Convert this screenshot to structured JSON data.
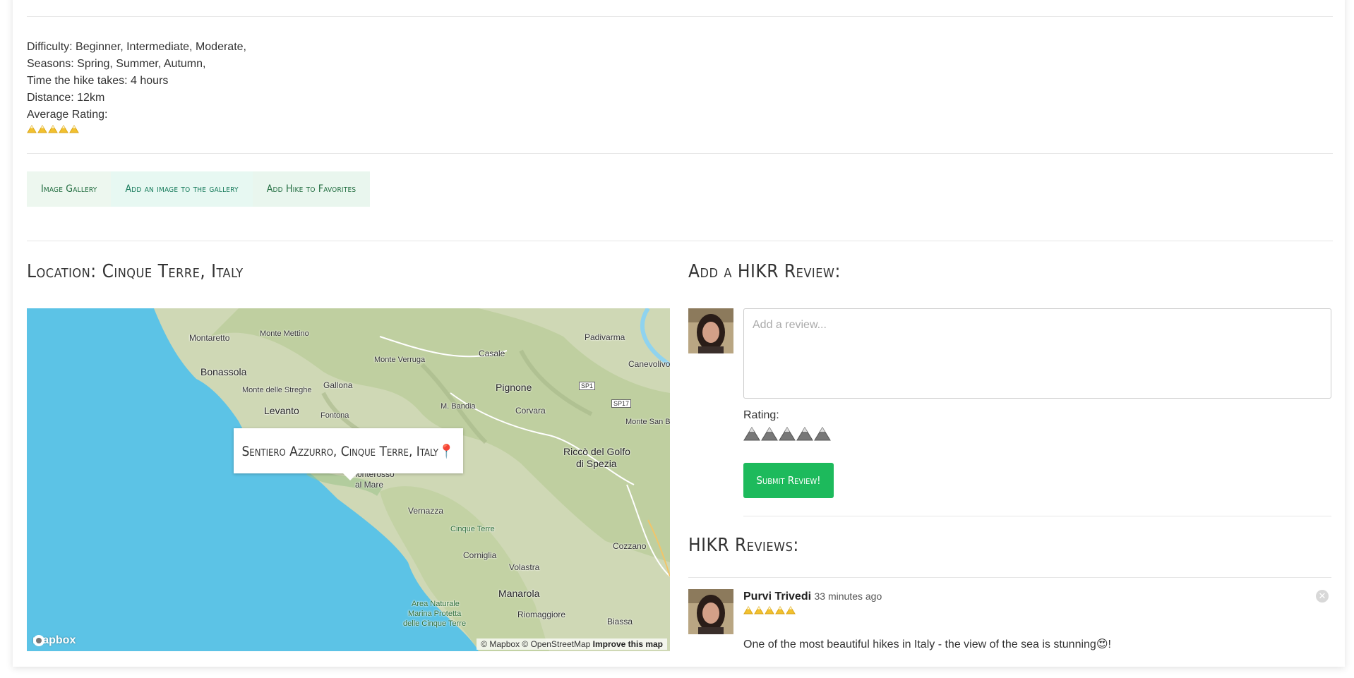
{
  "details": {
    "difficulty": "Difficulty: Beginner, Intermediate, Moderate,",
    "seasons": "Seasons: Spring, Summer, Autumn,",
    "time": "Time the hike takes: 4 hours",
    "distance": "Distance: 12km",
    "avg_label": "Average Rating:",
    "avg_rating": 5
  },
  "buttons": {
    "gallery": "Image Gallery",
    "add_image": "Add an image to the gallery",
    "favorites": "Add Hike to Favorites"
  },
  "location": {
    "heading": "Location: Cinque Terre, Italy",
    "popup": "Sentiero Azzurro, Cinque Terre, Italy📍"
  },
  "map": {
    "labels": {
      "montaretto": "Montaretto",
      "monte_mettino": "Monte Mettino",
      "padivarma": "Padivarma",
      "bonassola": "Bonassola",
      "monte_verruga": "Monte Verruga",
      "casale": "Casale",
      "canevolivo": "Canevolivo",
      "gallona": "Gallona",
      "monte_streghe": "Monte delle Streghe",
      "pignone": "Pignone",
      "sp1": "SP1",
      "levanto": "Levanto",
      "fontona": "Fontona",
      "m_bandia": "M. Bandia",
      "corvara": "Corvara",
      "sp17": "SP17",
      "monte_san_b": "Monte San B",
      "ricco": "Riccò del Golfo",
      "spezia": "di Spezia",
      "monterosso": "Monterosso",
      "al_mare": "al Mare",
      "vernazza": "Vernazza",
      "cinque_terre": "Cinque Terre",
      "corniglia": "Corniglia",
      "cozzano": "Cozzano",
      "volastra": "Volastra",
      "manarola": "Manarola",
      "area1": "Area Naturale",
      "area2": "Marina Protetta",
      "area3": "delle Cinque Terre",
      "riomaggiore": "Riomaggiore",
      "biassa": "Biassa"
    },
    "logo": "mapbox",
    "attribution": "© Mapbox © OpenStreetMap",
    "improve": "Improve this map"
  },
  "review_form": {
    "heading": "Add a HIKR Review:",
    "placeholder": "Add a review...",
    "rating_label": "Rating:",
    "rating_value": 0,
    "submit": "Submit Review!"
  },
  "reviews": {
    "heading": "HIKR Reviews:",
    "items": [
      {
        "author": "Purvi Trivedi",
        "time": "33 minutes ago",
        "rating": 5,
        "text": "One of the most beautiful hikes in Italy - the view of the sea is stunning😍!"
      }
    ]
  },
  "colors": {
    "accent_green": "#1dba5c",
    "rating_gold": "#f2c12e",
    "rating_empty": "#777777",
    "sea": "#5cc3e6"
  }
}
